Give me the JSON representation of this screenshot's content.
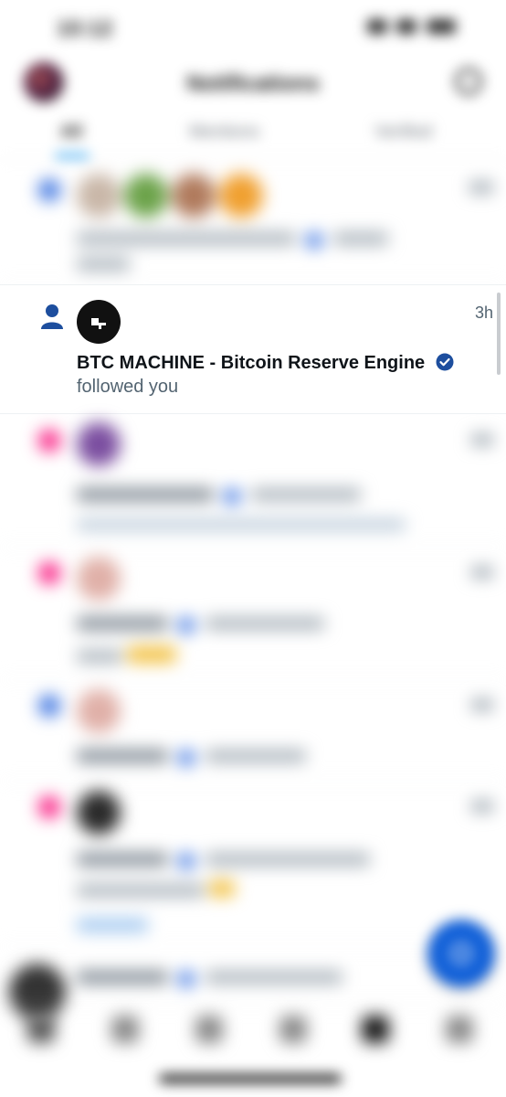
{
  "status_bar": {
    "time": "10:12"
  },
  "header": {
    "title": "Notifications"
  },
  "tabs": [
    {
      "label": "All"
    },
    {
      "label": "Mentions"
    },
    {
      "label": "Verified"
    }
  ],
  "focused_notification": {
    "type_icon": "person-icon",
    "account_name": "BTC MACHINE - Bitcoin Reserve Engine",
    "action": "followed you",
    "time": "3h",
    "verified": true
  },
  "colors": {
    "accent": "#1d9bf0",
    "verified_badge": "#1d4e9e",
    "like": "#f91880",
    "fab": "#1160d8"
  },
  "icons": {
    "fab": "compose-icon",
    "bottom_nav": [
      "home-icon",
      "search-icon",
      "grok-icon",
      "communities-icon",
      "notifications-icon",
      "messages-icon"
    ]
  }
}
